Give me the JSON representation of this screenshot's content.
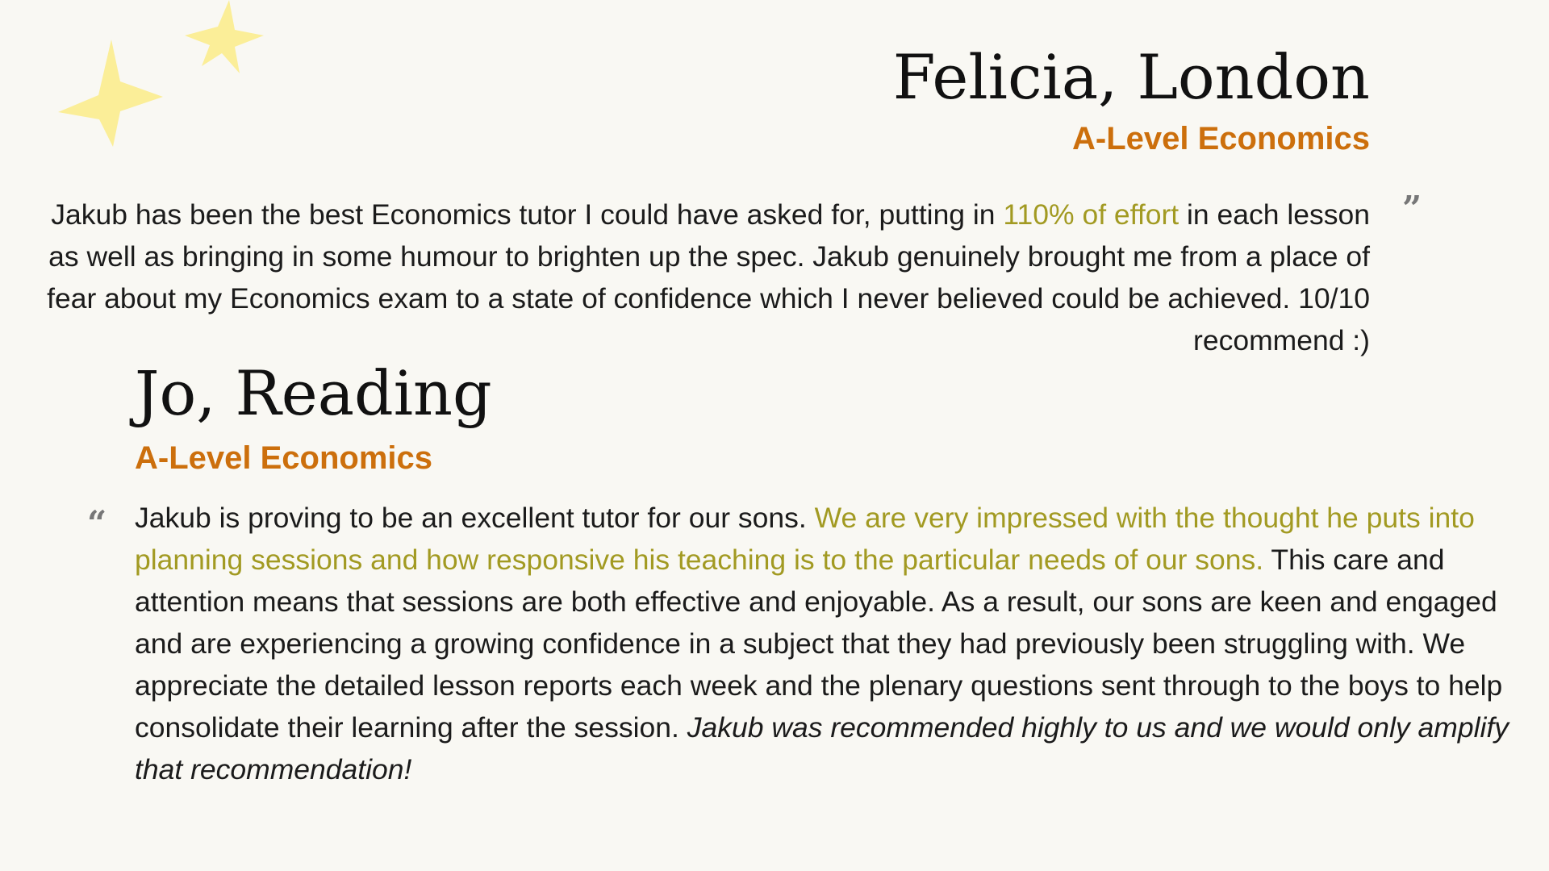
{
  "colors": {
    "background": "#f9f8f3",
    "subject_orange": "#cc6f0c",
    "highlight_olive": "#a29a22",
    "star_yellow": "#fbee98",
    "quote_mark_gray": "#777777"
  },
  "decoration": {
    "stars": [
      "star-icon",
      "star-icon"
    ]
  },
  "testimonials": [
    {
      "name": "Felicia, London",
      "subject": "A-Level Economics",
      "quote_mark": "”",
      "quote": {
        "part1": "Jakub has been the best Economics tutor I could have asked for, putting in ",
        "highlight": "110% of effort",
        "part2": " in each lesson as well as bringing in some humour to brighten up the spec. Jakub genuinely brought me from a place of fear about my Economics exam to a state of confidence which I never believed could be achieved. 10/10 recommend :)"
      }
    },
    {
      "name": "Jo, Reading",
      "subject": "A-Level Economics",
      "quote_mark": "“",
      "quote": {
        "part1": "Jakub is proving to be an excellent tutor for our sons. ",
        "highlight": "We are very impressed with the thought he puts into planning sessions and how responsive his teaching is to the particular needs of our sons.",
        "part2": " This care and attention means that sessions are both effective and enjoyable. As a result, our sons are keen and engaged and are experiencing a growing confidence in a subject that they had previously been struggling with. We appreciate the detailed lesson reports each week and the plenary questions sent through to the boys to help consolidate their learning after the session. ",
        "italic": "Jakub was recommended highly to us and we would only amplify that recommendation!"
      }
    }
  ]
}
